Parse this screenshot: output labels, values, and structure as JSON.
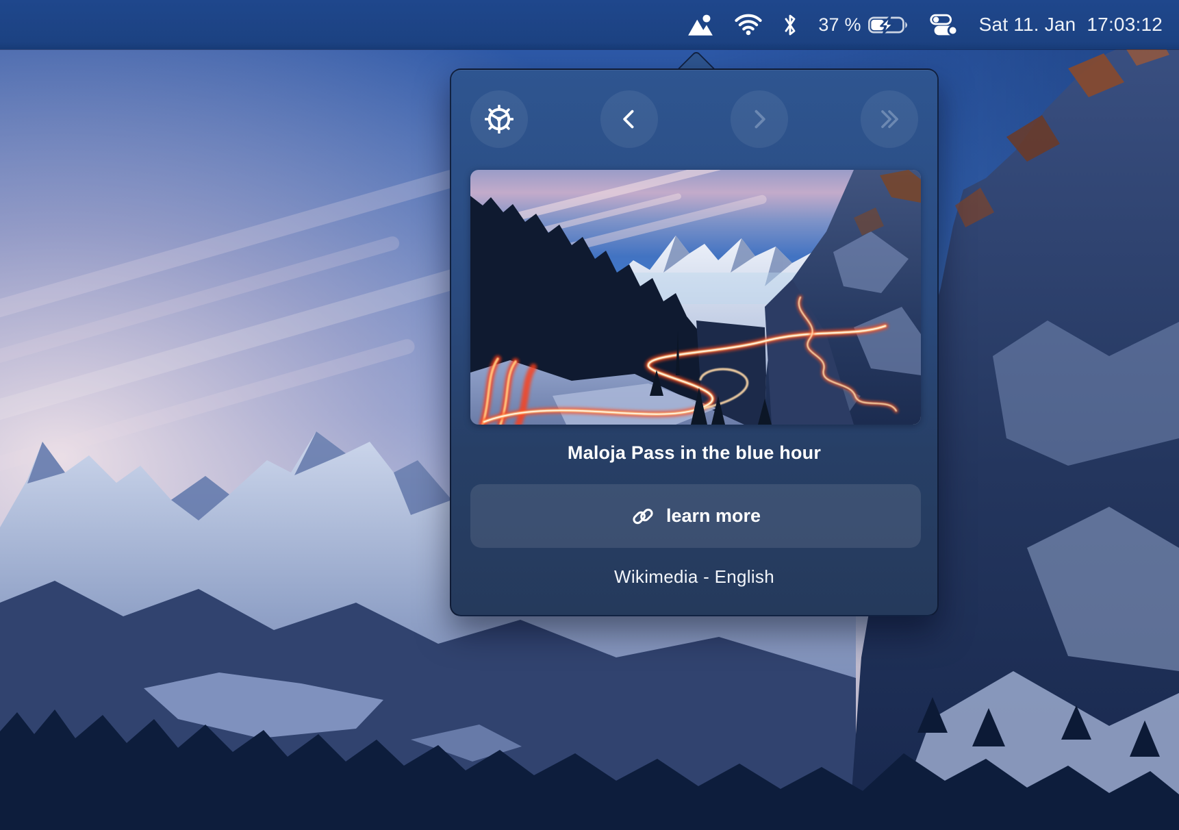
{
  "menu_bar": {
    "icons": [
      {
        "name": "photo-widget-app-icon"
      },
      {
        "name": "wifi-icon"
      },
      {
        "name": "bluetooth-icon"
      },
      {
        "name": "battery-charging-icon"
      },
      {
        "name": "control-center-icon"
      }
    ],
    "battery_percent": "37 %",
    "clock": "Sat 11. Jan  17:03:12"
  },
  "popover": {
    "toolbar": {
      "buttons": [
        {
          "name": "settings-button",
          "icon": "gear-icon",
          "enabled": true
        },
        {
          "name": "previous-button",
          "icon": "chevron-left-icon",
          "enabled": true
        },
        {
          "name": "next-button",
          "icon": "chevron-right-icon",
          "enabled": false
        },
        {
          "name": "skip-forward-button",
          "icon": "double-chevron-right-icon",
          "enabled": false
        }
      ]
    },
    "photo_title": "Maloja Pass in the blue hour",
    "learn_more_label": "learn more",
    "learn_more_icon": "link-icon",
    "source_label": "Wikimedia - English"
  },
  "colors": {
    "menu_bar_bg": "#1c4282",
    "popover_top": "#2e5590",
    "popover_bottom": "#253a5c",
    "light_trail_accent": "#ff4a1a"
  }
}
